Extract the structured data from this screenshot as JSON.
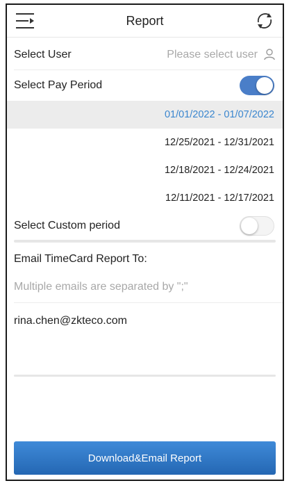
{
  "header": {
    "title": "Report",
    "menu_icon": "menu-icon",
    "refresh_icon": "refresh-icon"
  },
  "select_user": {
    "label": "Select User",
    "placeholder": "Please select user",
    "icon": "user-icon"
  },
  "pay_period": {
    "label": "Select Pay Period",
    "toggle_on": true,
    "options": [
      {
        "text": "01/01/2022 - 01/07/2022",
        "selected": true
      },
      {
        "text": "12/25/2021 - 12/31/2021",
        "selected": false
      },
      {
        "text": "12/18/2021 - 12/24/2021",
        "selected": false
      },
      {
        "text": "12/11/2021 - 12/17/2021",
        "selected": false
      }
    ]
  },
  "custom_period": {
    "label": "Select Custom period",
    "toggle_on": false
  },
  "email": {
    "label": "Email TimeCard Report To:",
    "hint": "Multiple emails are separated by \";\"",
    "value": "rina.chen@zkteco.com"
  },
  "submit": {
    "label": "Download&Email Report"
  },
  "colors": {
    "accent": "#4a7ec8",
    "selected_text": "#3a86cf",
    "button": "#2e74c2"
  }
}
